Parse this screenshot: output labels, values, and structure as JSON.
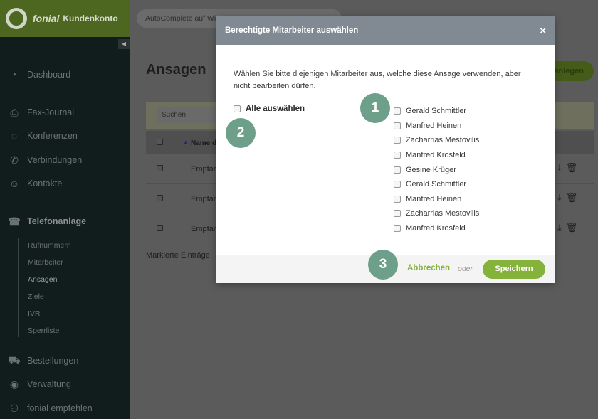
{
  "brand": {
    "name": "fonial",
    "subtitle": "Kundenkonto"
  },
  "topbar": {
    "search_value": "AutoComplete auf Wi…"
  },
  "sidebar": {
    "items": [
      {
        "label": "Dashboard",
        "icon": "gauge-icon"
      },
      {
        "label": "Fax-Journal",
        "icon": "printer-icon"
      },
      {
        "label": "Konferenzen",
        "icon": "chat-icon"
      },
      {
        "label": "Verbindungen",
        "icon": "phone-icon"
      },
      {
        "label": "Kontakte",
        "icon": "contacts-icon"
      },
      {
        "label": "Telefonanlage",
        "icon": "pbx-icon",
        "active": true
      },
      {
        "label": "Bestellungen",
        "icon": "cart-icon"
      },
      {
        "label": "Verwaltung",
        "icon": "user-icon"
      },
      {
        "label": "fonial empfehlen",
        "icon": "people-icon"
      }
    ],
    "sub_items": [
      {
        "label": "Rufnummern"
      },
      {
        "label": "Mitarbeiter"
      },
      {
        "label": "Ansagen",
        "active": true
      },
      {
        "label": "Ziele"
      },
      {
        "label": "IVR"
      },
      {
        "label": "Sperrliste"
      }
    ]
  },
  "main": {
    "title": "Ansagen",
    "add_button": "anlegen",
    "filter_placeholder": "Suchen",
    "column_name": "Name de",
    "rows": [
      {
        "name": "Empfan"
      },
      {
        "name": "Empfan"
      },
      {
        "name": "Empfan"
      }
    ],
    "footer": "Markierte Einträge"
  },
  "modal": {
    "title": "Berechtigte Mitarbeiter auswählen",
    "close": "×",
    "description": "Wählen Sie bitte diejenigen Mitarbeiter aus, welche diese Ansage verwenden, aber nicht bearbeiten dürfen.",
    "select_all": "Alle auswählen",
    "employees": [
      "Gerald Schmittler",
      "Manfred Heinen",
      "Zacharrias Mestovilis",
      "Manfred Krosfeld",
      "Gesine Krüger",
      "Gerald Schmittler",
      "Manfred Heinen",
      "Zacharrias Mestovilis",
      "Manfred Krosfeld"
    ],
    "cancel": "Abbrechen",
    "or": "oder",
    "save": "Speichern"
  },
  "callouts": [
    "1",
    "2",
    "3"
  ],
  "colors": {
    "accent": "#84b23a",
    "header": "#818a93",
    "callout": "#6e9f8b",
    "brand": "#7a9f2f"
  }
}
